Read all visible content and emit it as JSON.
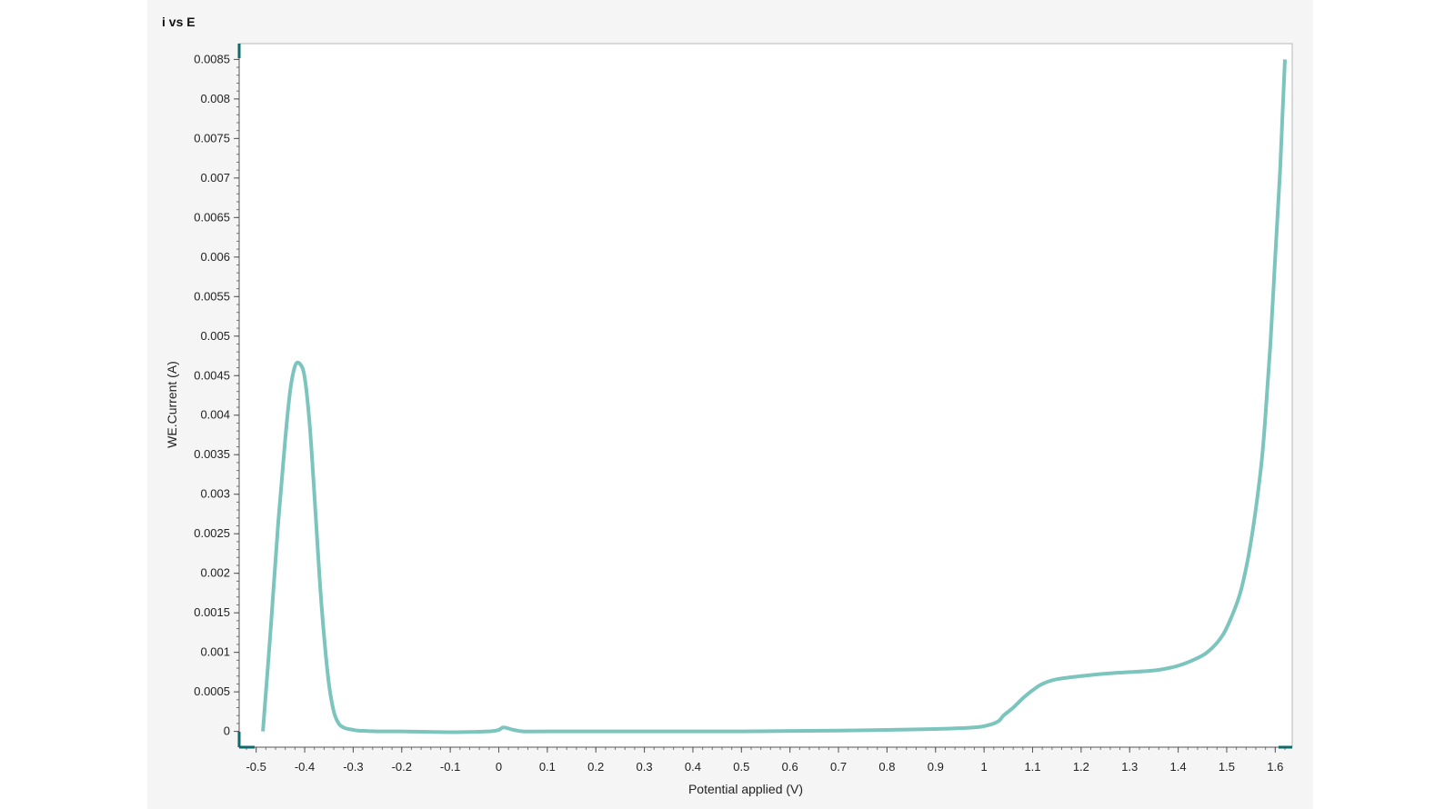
{
  "chart_data": {
    "type": "line",
    "title": "i vs E",
    "xlabel": "Potential applied (V)",
    "ylabel": "WE.Current (A)",
    "xlim": [
      -0.535,
      1.635
    ],
    "ylim": [
      -0.0002,
      0.0087
    ],
    "x_ticks": [
      "-0.5",
      "-0.4",
      "-0.3",
      "-0.2",
      "-0.1",
      "0",
      "0.1",
      "0.2",
      "0.3",
      "0.4",
      "0.5",
      "0.6",
      "0.7",
      "0.8",
      "0.9",
      "1",
      "1.1",
      "1.2",
      "1.3",
      "1.4",
      "1.5",
      "1.6"
    ],
    "y_ticks": [
      "0",
      "0.0005",
      "0.001",
      "0.0015",
      "0.002",
      "0.0025",
      "0.003",
      "0.0035",
      "0.004",
      "0.0045",
      "0.005",
      "0.0055",
      "0.006",
      "0.0065",
      "0.007",
      "0.0075",
      "0.008",
      "0.0085"
    ],
    "grid": false,
    "series": [
      {
        "color": "#7cc4be",
        "x": [
          -0.486,
          -0.47,
          -0.455,
          -0.44,
          -0.43,
          -0.42,
          -0.41,
          -0.4,
          -0.39,
          -0.38,
          -0.37,
          -0.36,
          -0.35,
          -0.34,
          -0.33,
          -0.32,
          -0.31,
          -0.3,
          -0.29,
          -0.27,
          -0.25,
          -0.2,
          -0.1,
          -0.02,
          0.0,
          0.01,
          0.03,
          0.05,
          0.1,
          0.3,
          0.5,
          0.7,
          0.9,
          0.98,
          1.01,
          1.03,
          1.04,
          1.06,
          1.08,
          1.1,
          1.12,
          1.15,
          1.2,
          1.25,
          1.3,
          1.35,
          1.38,
          1.4,
          1.43,
          1.46,
          1.49,
          1.51,
          1.53,
          1.55,
          1.57,
          1.58,
          1.59,
          1.6,
          1.61,
          1.615,
          1.62
        ],
        "y": [
          0.0,
          0.0013,
          0.0026,
          0.0037,
          0.0043,
          0.00462,
          0.00465,
          0.00448,
          0.0039,
          0.003,
          0.002,
          0.0012,
          0.0006,
          0.00025,
          0.0001,
          5e-05,
          3e-05,
          2e-05,
          1e-05,
          5e-06,
          0.0,
          0.0,
          -1e-05,
          0.0,
          2e-05,
          5e-05,
          2e-05,
          0.0,
          0.0,
          0.0,
          0.0,
          1e-05,
          3e-05,
          5e-05,
          8e-05,
          0.00013,
          0.0002,
          0.0003,
          0.00042,
          0.00052,
          0.0006,
          0.00066,
          0.0007,
          0.00073,
          0.00075,
          0.00077,
          0.0008,
          0.00083,
          0.0009,
          0.001,
          0.0012,
          0.00145,
          0.0018,
          0.0024,
          0.0033,
          0.004,
          0.0049,
          0.006,
          0.0071,
          0.0078,
          0.0085
        ]
      }
    ]
  }
}
